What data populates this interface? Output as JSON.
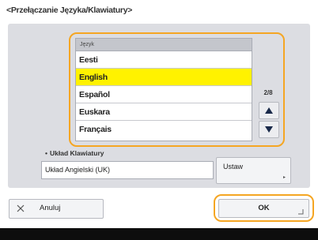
{
  "dialog": {
    "title": "<Przełączanie Języka/Klawiatury>"
  },
  "language_list": {
    "header": "Język",
    "items": [
      "Eesti",
      "English",
      "Español",
      "Euskara",
      "Français"
    ],
    "selected": "English",
    "page_indicator": "2/8"
  },
  "keyboard": {
    "label": "Układ Klawiatury",
    "value": "Układ Angielski (UK)",
    "set_button_label": "Ustaw"
  },
  "footer": {
    "cancel_label": "Anuluj",
    "ok_label": "OK"
  },
  "colors": {
    "highlight_outline": "#f5a623",
    "selected_row": "#fff200",
    "panel_bg": "#dcdde2"
  }
}
